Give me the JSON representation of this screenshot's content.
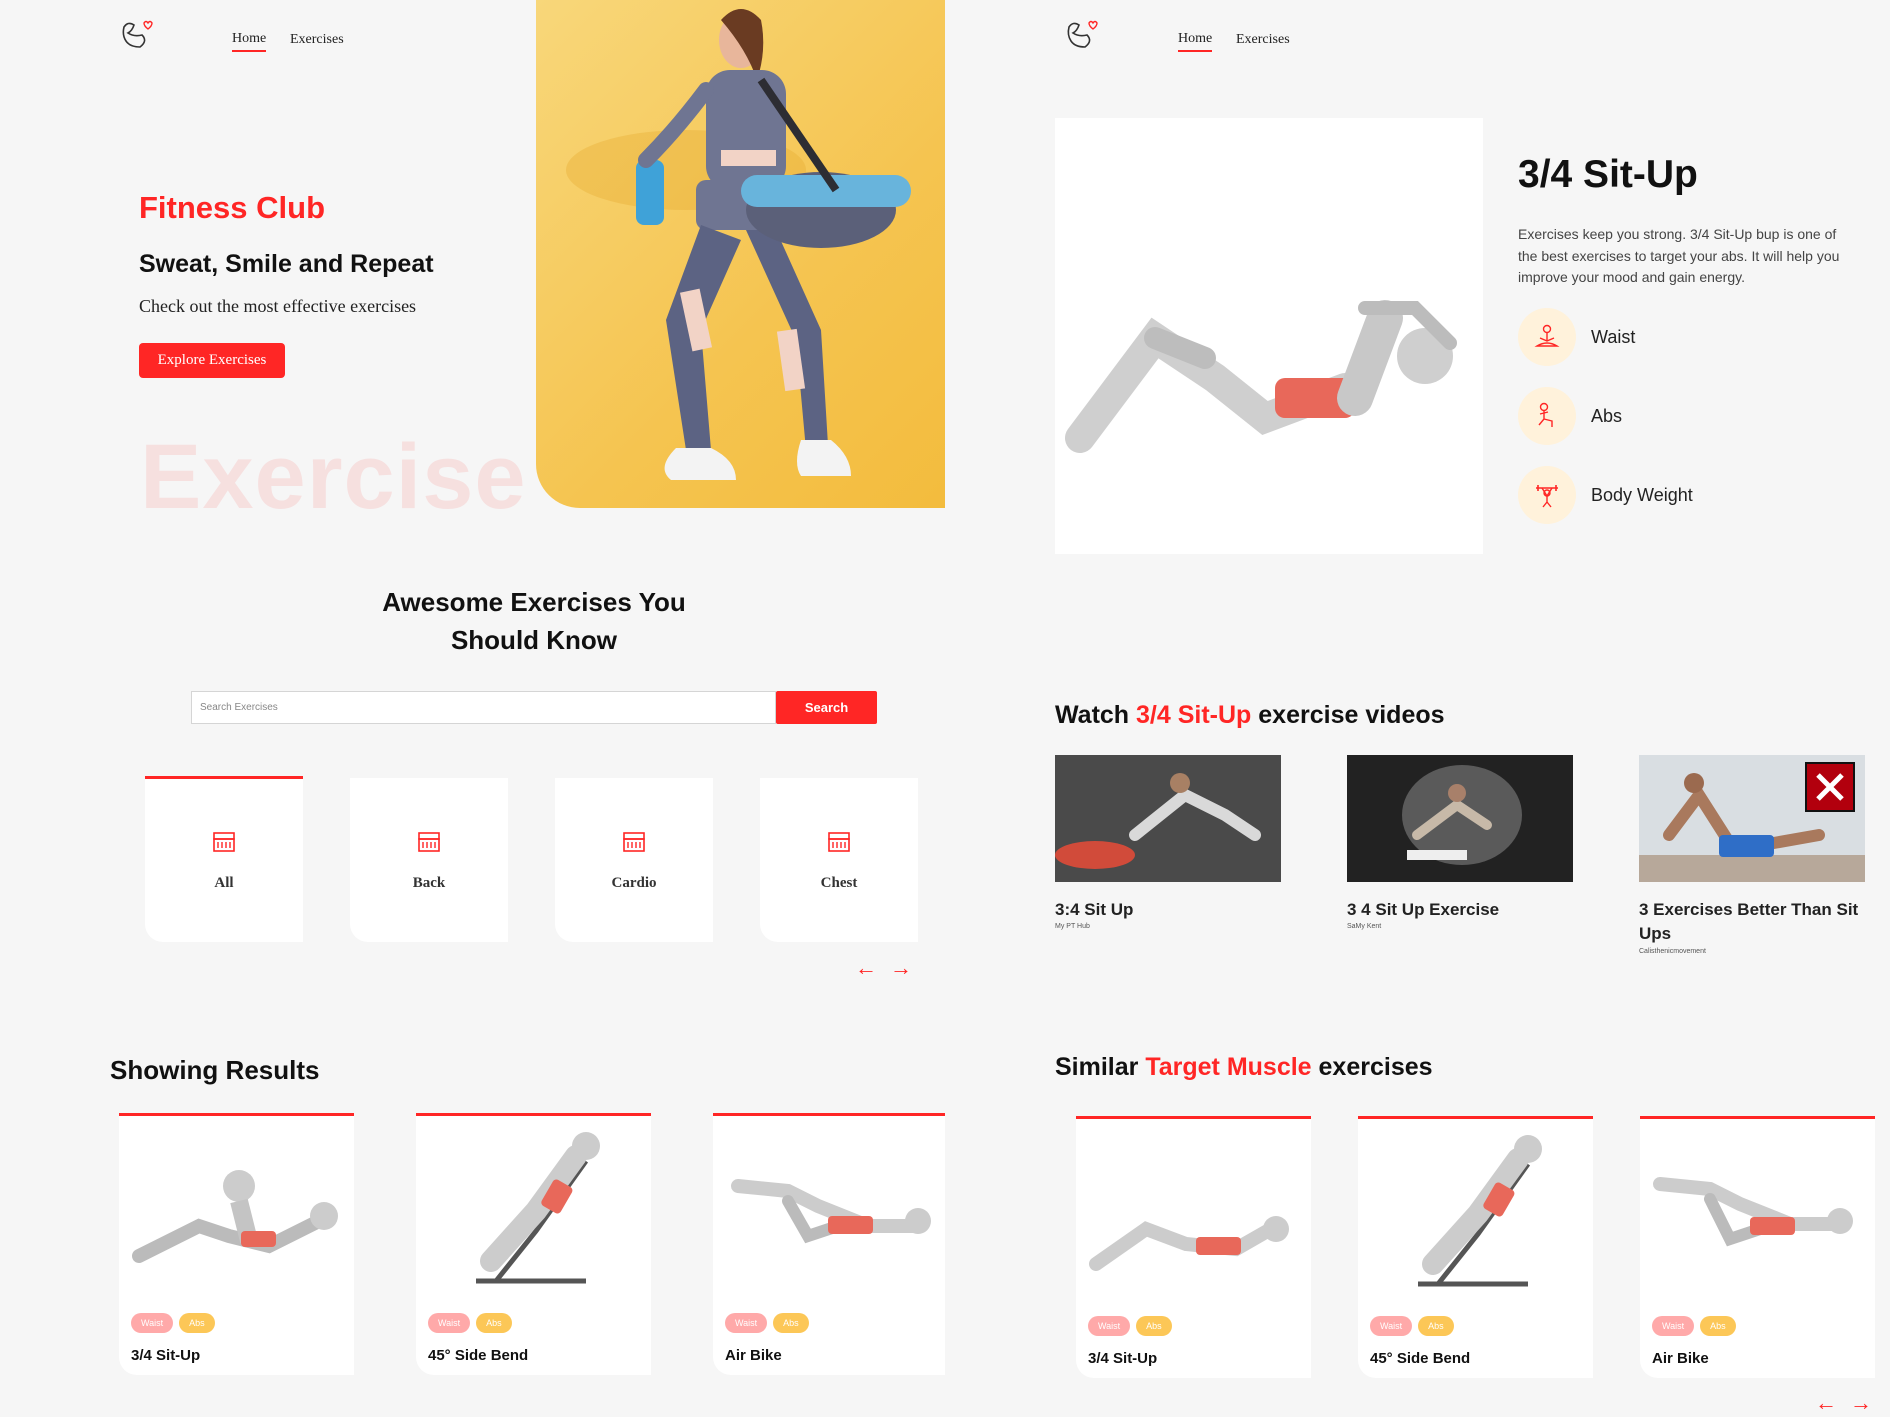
{
  "nav": {
    "home": "Home",
    "exercises": "Exercises"
  },
  "hero": {
    "title": "Fitness Club",
    "subtitle": "Sweat, Smile and Repeat",
    "text": "Check out the most effective exercises",
    "button": "Explore Exercises",
    "background_word": "Exercise"
  },
  "search": {
    "heading_line1": "Awesome Exercises You",
    "heading_line2": "Should Know",
    "placeholder": "Search Exercises",
    "button": "Search"
  },
  "categories": [
    "All",
    "Back",
    "Cardio",
    "Chest"
  ],
  "arrows": {
    "prev": "←",
    "next": "→"
  },
  "results": {
    "heading": "Showing Results",
    "cards": [
      {
        "name": "3/4 Sit-Up",
        "tags": [
          "Waist",
          "Abs"
        ]
      },
      {
        "name": "45° Side Bend",
        "tags": [
          "Waist",
          "Abs"
        ]
      },
      {
        "name": "Air Bike",
        "tags": [
          "Waist",
          "Abs"
        ]
      }
    ]
  },
  "detail": {
    "title": "3/4 Sit-Up",
    "description": "Exercises keep you strong. 3/4 Sit-Up bup is one of the best exercises to target your abs. It will help you improve your mood and gain energy.",
    "tags": [
      "Waist",
      "Abs",
      "Body Weight"
    ]
  },
  "videos": {
    "heading_pre": "Watch ",
    "heading_highlight": "3/4 Sit-Up",
    "heading_post": " exercise videos",
    "items": [
      {
        "title": "3:4 Sit Up",
        "channel": "My PT Hub"
      },
      {
        "title": "3 4 Sit Up Exercise",
        "channel": "SaMy Kent"
      },
      {
        "title": "3 Exercises Better Than Sit Ups",
        "channel": "Calisthenicmovement"
      }
    ]
  },
  "similar": {
    "heading_pre": "Similar ",
    "heading_highlight": "Target Muscle",
    "heading_post": " exercises",
    "cards": [
      {
        "name": "3/4 Sit-Up",
        "tags": [
          "Waist",
          "Abs"
        ]
      },
      {
        "name": "45° Side Bend",
        "tags": [
          "Waist",
          "Abs"
        ]
      },
      {
        "name": "Air Bike",
        "tags": [
          "Waist",
          "Abs"
        ]
      }
    ]
  },
  "colors": {
    "accent": "#ff2625",
    "waist_pill": "#ffa9a9",
    "abs_pill": "#fcc757",
    "tag_circle": "#fff2db",
    "hero_bg": "#f5c450"
  }
}
